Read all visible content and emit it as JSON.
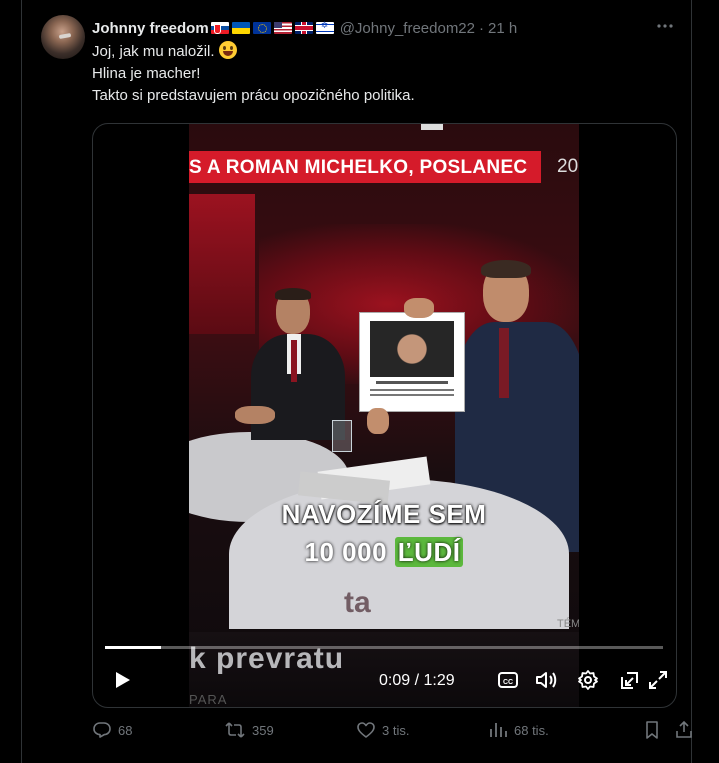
{
  "author": {
    "name": "Johnny freedom",
    "handle": "@Johny_freedom22",
    "separator": "·",
    "time": "21 h",
    "flags": [
      "slovakia-flag",
      "ukraine-flag",
      "eu-flag",
      "usa-flag",
      "uk-flag",
      "israel-flag"
    ]
  },
  "tweet": {
    "line1": "Joj, jak mu naložil.",
    "line2": "Hlina je macher!",
    "line3": "Takto si predstavujem prácu opozičného politika."
  },
  "video": {
    "lower_third": "S A ROMAN MICHELKO, POSLANEC",
    "lower_third_number": "20",
    "subtitle_line1": "NAVOZÍME SEM",
    "subtitle_line2_prefix": "10 000",
    "subtitle_line2_highlight": "ĽUDÍ",
    "bottom_banner": "k prevratu",
    "bottom_sub": "PARA",
    "ticker_tag": "TÉM",
    "time_current": "0:09",
    "time_total": "1:29",
    "progress": 0.1
  },
  "stats": {
    "replies": "68",
    "reposts": "359",
    "likes": "3 tis.",
    "views": "68 tis."
  },
  "colors": {
    "background": "#000000",
    "muted": "#71767b",
    "text": "#e7e9ea",
    "news_red": "#d51b2a",
    "subtitle_highlight": "#5cb83d"
  }
}
